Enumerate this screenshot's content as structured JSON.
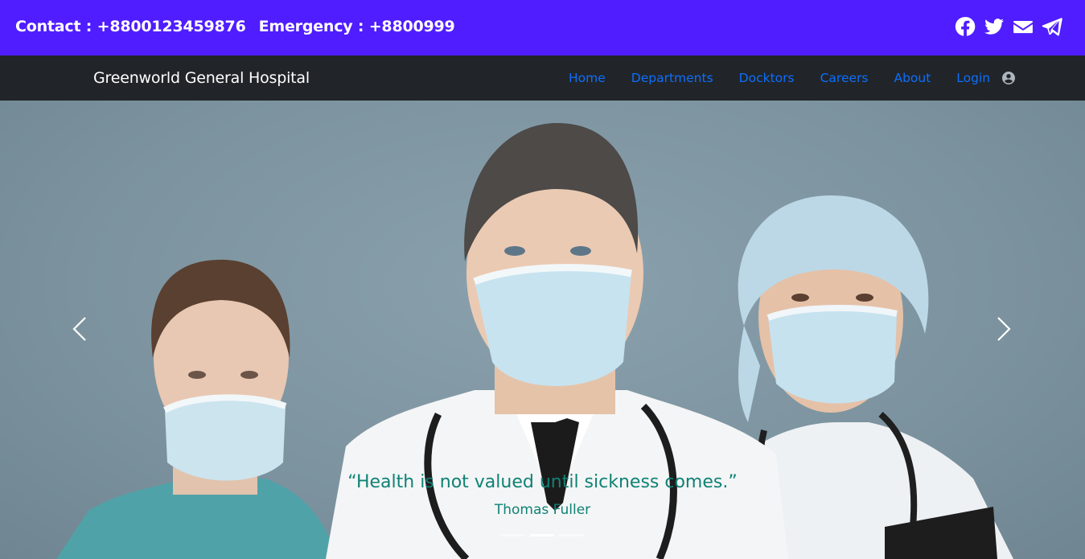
{
  "topbar": {
    "contact": "Contact : +8800123459876",
    "emergency": "Emergency : +8800999",
    "social_icons": [
      "facebook-icon",
      "twitter-icon",
      "envelope-icon",
      "telegram-icon"
    ],
    "background": "#4f1dff"
  },
  "navbar": {
    "brand": "Greenworld General Hospital",
    "links": [
      "Home",
      "Departments",
      "Docktors",
      "Careers",
      "About",
      "Login"
    ],
    "link_color": "#0d6efd",
    "background": "#212529"
  },
  "carousel": {
    "quote": "“Health is not valued until sickness comes.”",
    "author": "Thomas Fuller",
    "slides": 3,
    "active_slide": 2,
    "caption_color": "#0f8275"
  }
}
